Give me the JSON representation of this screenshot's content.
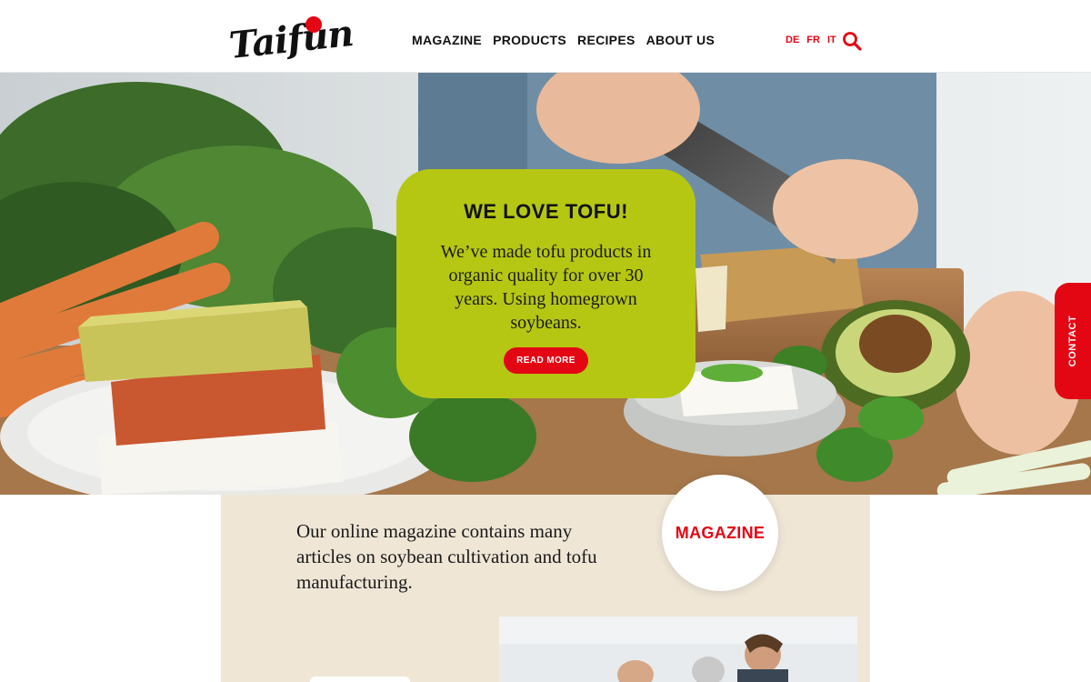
{
  "brand": {
    "logo_text": "Taifun",
    "accent_color": "#e30613",
    "card_color": "#b5c713"
  },
  "nav": {
    "items": [
      {
        "label": "MAGAZINE"
      },
      {
        "label": "PRODUCTS"
      },
      {
        "label": "RECIPES"
      },
      {
        "label": "ABOUT US"
      }
    ]
  },
  "languages": [
    "DE",
    "FR",
    "IT"
  ],
  "icons": {
    "search": "search-icon"
  },
  "hero": {
    "title": "WE LOVE TOFU!",
    "text": "We’ve made tofu products in organic quality for over 30 years. Using homegrown soybeans.",
    "button_label": "READ MORE"
  },
  "contact": {
    "label": "CONTACT"
  },
  "magazine": {
    "text": "Our online magazine contains many articles on soybean cultivation and tofu manufacturing.",
    "circle_label": "MAGAZINE"
  }
}
